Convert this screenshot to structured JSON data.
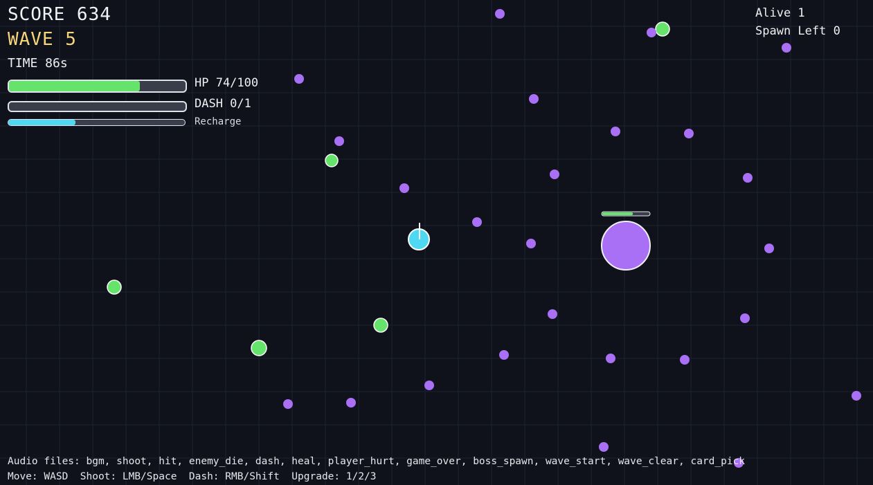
{
  "hud": {
    "score": "SCORE 634",
    "wave": "WAVE 5",
    "time": "TIME 86s",
    "hp_label": "HP 74/100",
    "hp_fraction": 0.74,
    "dash_label": "DASH 0/1",
    "dash_fraction": 0,
    "recharge_label": "Recharge",
    "recharge_fraction": 0.38,
    "alive": "Alive 1",
    "spawn_left": "Spawn Left 0"
  },
  "footer": {
    "audio": "Audio files: bgm, shoot, hit, enemy_die, dash, heal, player_hurt, game_over, boss_spawn, wave_start, wave_clear, card_pick",
    "controls": "Move: WASD  Shoot: LMB/Space  Dash: RMB/Shift  Upgrade: 1/2/3"
  },
  "colors": {
    "background": "#10121b",
    "grid": "#1c2030",
    "enemy": "#a970f5",
    "pickup": "#66e36a",
    "player": "#4fd8f2",
    "hp_fill": "#66e36a",
    "recharge_fill": "#4fd8f2",
    "wave_text": "#f6d67a"
  },
  "boss": {
    "hp_fraction": 0.65
  }
}
